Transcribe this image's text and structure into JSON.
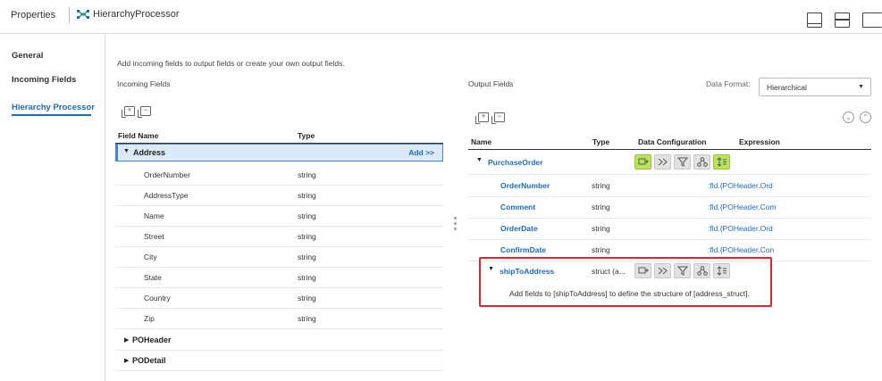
{
  "header": {
    "properties_label": "Properties",
    "title": "HierarchyProcessor"
  },
  "nav": {
    "items": [
      {
        "label": "General",
        "active": false
      },
      {
        "label": "Incoming Fields",
        "active": false
      },
      {
        "label": "Hierarchy Processor",
        "active": true
      }
    ]
  },
  "instructions": "Add incoming fields to output fields or create your own output fields.",
  "incoming": {
    "panel_label": "Incoming Fields",
    "col_name": "Field Name",
    "col_type": "Type",
    "selected_group": "Address",
    "add_label": "Add >>",
    "rows": [
      {
        "name": "OrderNumber",
        "type": "string"
      },
      {
        "name": "AddressType",
        "type": "string"
      },
      {
        "name": "Name",
        "type": "string"
      },
      {
        "name": "Street",
        "type": "string"
      },
      {
        "name": "City",
        "type": "string"
      },
      {
        "name": "State",
        "type": "string"
      },
      {
        "name": "Country",
        "type": "string"
      },
      {
        "name": "Zip",
        "type": "string"
      }
    ],
    "groups": [
      "POHeader",
      "PODetail"
    ]
  },
  "output": {
    "panel_label": "Output Fields",
    "format_label": "Data Format:",
    "format_value": "Hierarchical",
    "col_name": "Name",
    "col_type": "Type",
    "col_config": "Data Configuration",
    "col_expr": "Expression",
    "root": "PurchaseOrder",
    "rows": [
      {
        "name": "OrderNumber",
        "type": "string",
        "expr": ":fld.{POHeader.Ord"
      },
      {
        "name": "Comment",
        "type": "string",
        "expr": ":fld.{POHeader.Com"
      },
      {
        "name": "OrderDate",
        "type": "string",
        "expr": ":fld.{POHeader.Ord"
      },
      {
        "name": "ConfirmDate",
        "type": "string",
        "expr": ":fld.{POHeader.Con"
      }
    ],
    "struct": {
      "name": "shipToAddress",
      "type": "struct (a..."
    },
    "hint": "Add fields to [shipToAddress] to define the structure of [address_struct]."
  },
  "colors": {
    "accent": "#1a6bbd",
    "selected_bg": "#dbe9f9",
    "config_active": "#b9e45a",
    "highlight": "#e0262c"
  }
}
